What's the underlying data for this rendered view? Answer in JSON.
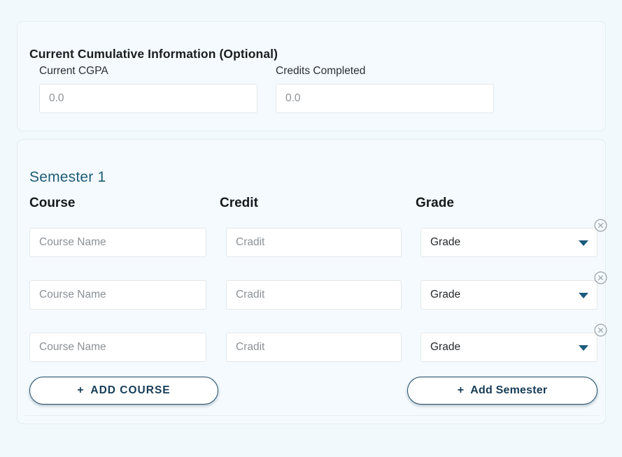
{
  "theme": {
    "page_bg": "#f2f9fc",
    "card_bg": "#f4fafd",
    "card_border": "#e4edf2",
    "accent_teal": "#1f5c77",
    "button_border": "#1f4a66",
    "button_text": "#163c56",
    "caret_color": "#1b5a7c",
    "remove_icon_color": "#9aa1a8",
    "placeholder_color": "#8c9196"
  },
  "cumulative": {
    "title": "Current Cumulative Information (Optional)",
    "fields": [
      {
        "label": "Current CGPA",
        "value": "",
        "placeholder": "0.0"
      },
      {
        "label": "Credits Completed",
        "value": "",
        "placeholder": "0.0"
      }
    ]
  },
  "semester": {
    "title": "Semester 1",
    "columns": {
      "course": "Course",
      "credit": "Credit",
      "grade": "Grade"
    },
    "rows": [
      {
        "course": {
          "value": "",
          "placeholder": "Course Name"
        },
        "credit": {
          "value": "",
          "placeholder": "Cradit"
        },
        "grade": {
          "value": "Grade"
        },
        "remove_icon": "circle-x-icon"
      },
      {
        "course": {
          "value": "",
          "placeholder": "Course Name"
        },
        "credit": {
          "value": "",
          "placeholder": "Cradit"
        },
        "grade": {
          "value": "Grade"
        },
        "remove_icon": "circle-x-icon"
      },
      {
        "course": {
          "value": "",
          "placeholder": "Course Name"
        },
        "credit": {
          "value": "",
          "placeholder": "Cradit"
        },
        "grade": {
          "value": "Grade"
        },
        "remove_icon": "circle-x-icon"
      }
    ],
    "add_course_button": {
      "plus": "+",
      "label": "ADD COURSE"
    },
    "add_semester_button": {
      "plus": "+",
      "label": "Add Semester"
    }
  }
}
